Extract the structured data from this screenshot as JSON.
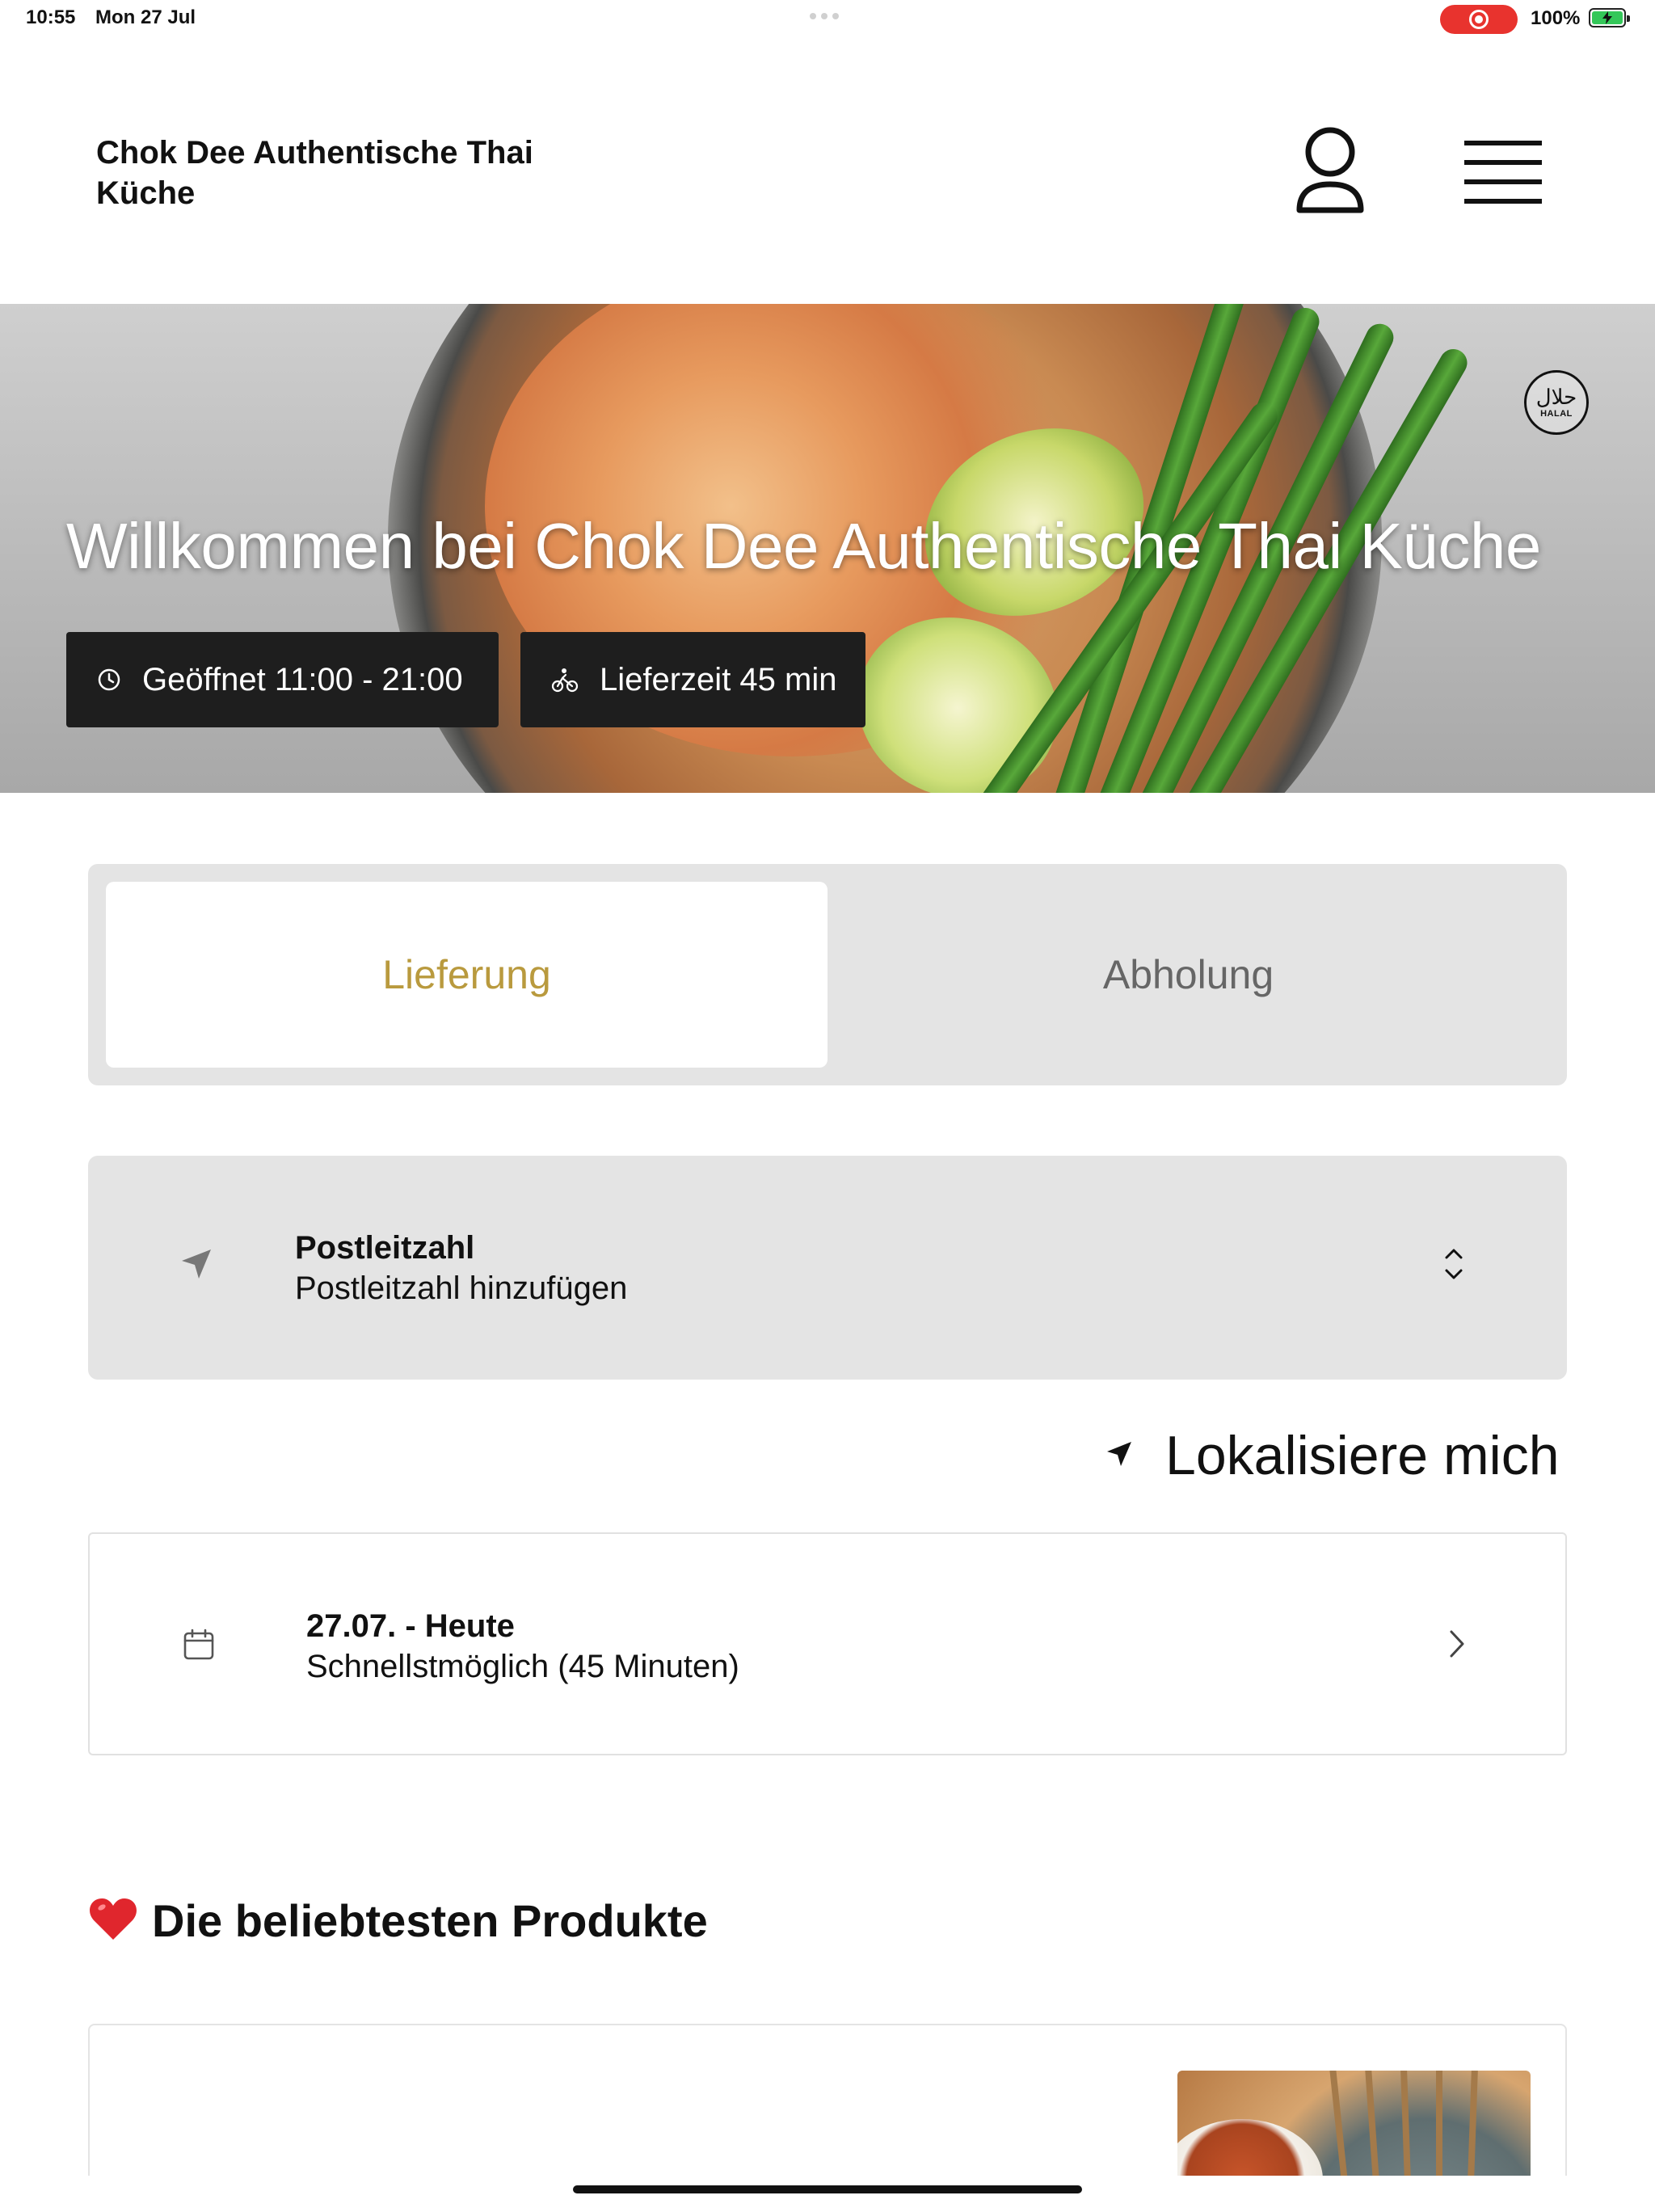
{
  "status_bar": {
    "time": "10:55",
    "date": "Mon 27 Jul",
    "battery": "100%",
    "recording_color": "#e8332e"
  },
  "header": {
    "brand": "Chok Dee Authentische Thai Küche",
    "account_icon": "person-icon",
    "menu_icon": "hamburger-menu-icon"
  },
  "hero": {
    "title": "Willkommen bei Chok Dee Authentische Thai Küche",
    "badge_arabic": "حلال",
    "badge_latin": "HALAL",
    "chips": {
      "opening_hours": "Geöffnet 11:00 - 21:00",
      "delivery_time": "Lieferzeit 45 min"
    }
  },
  "mode_switch": {
    "delivery": "Lieferung",
    "pickup": "Abholung",
    "selected": "Lieferung",
    "accent_color": "#b99a3e"
  },
  "postal": {
    "title": "Postleitzahl",
    "placeholder": "Postleitzahl hinzufügen"
  },
  "locate": {
    "label": "Lokalisiere mich"
  },
  "schedule": {
    "title": "27.07. - Heute",
    "subtitle": "Schnellstmöglich (45 Minuten)"
  },
  "popular": {
    "emoji": "❤️",
    "title": "Die beliebtesten Produkte"
  }
}
